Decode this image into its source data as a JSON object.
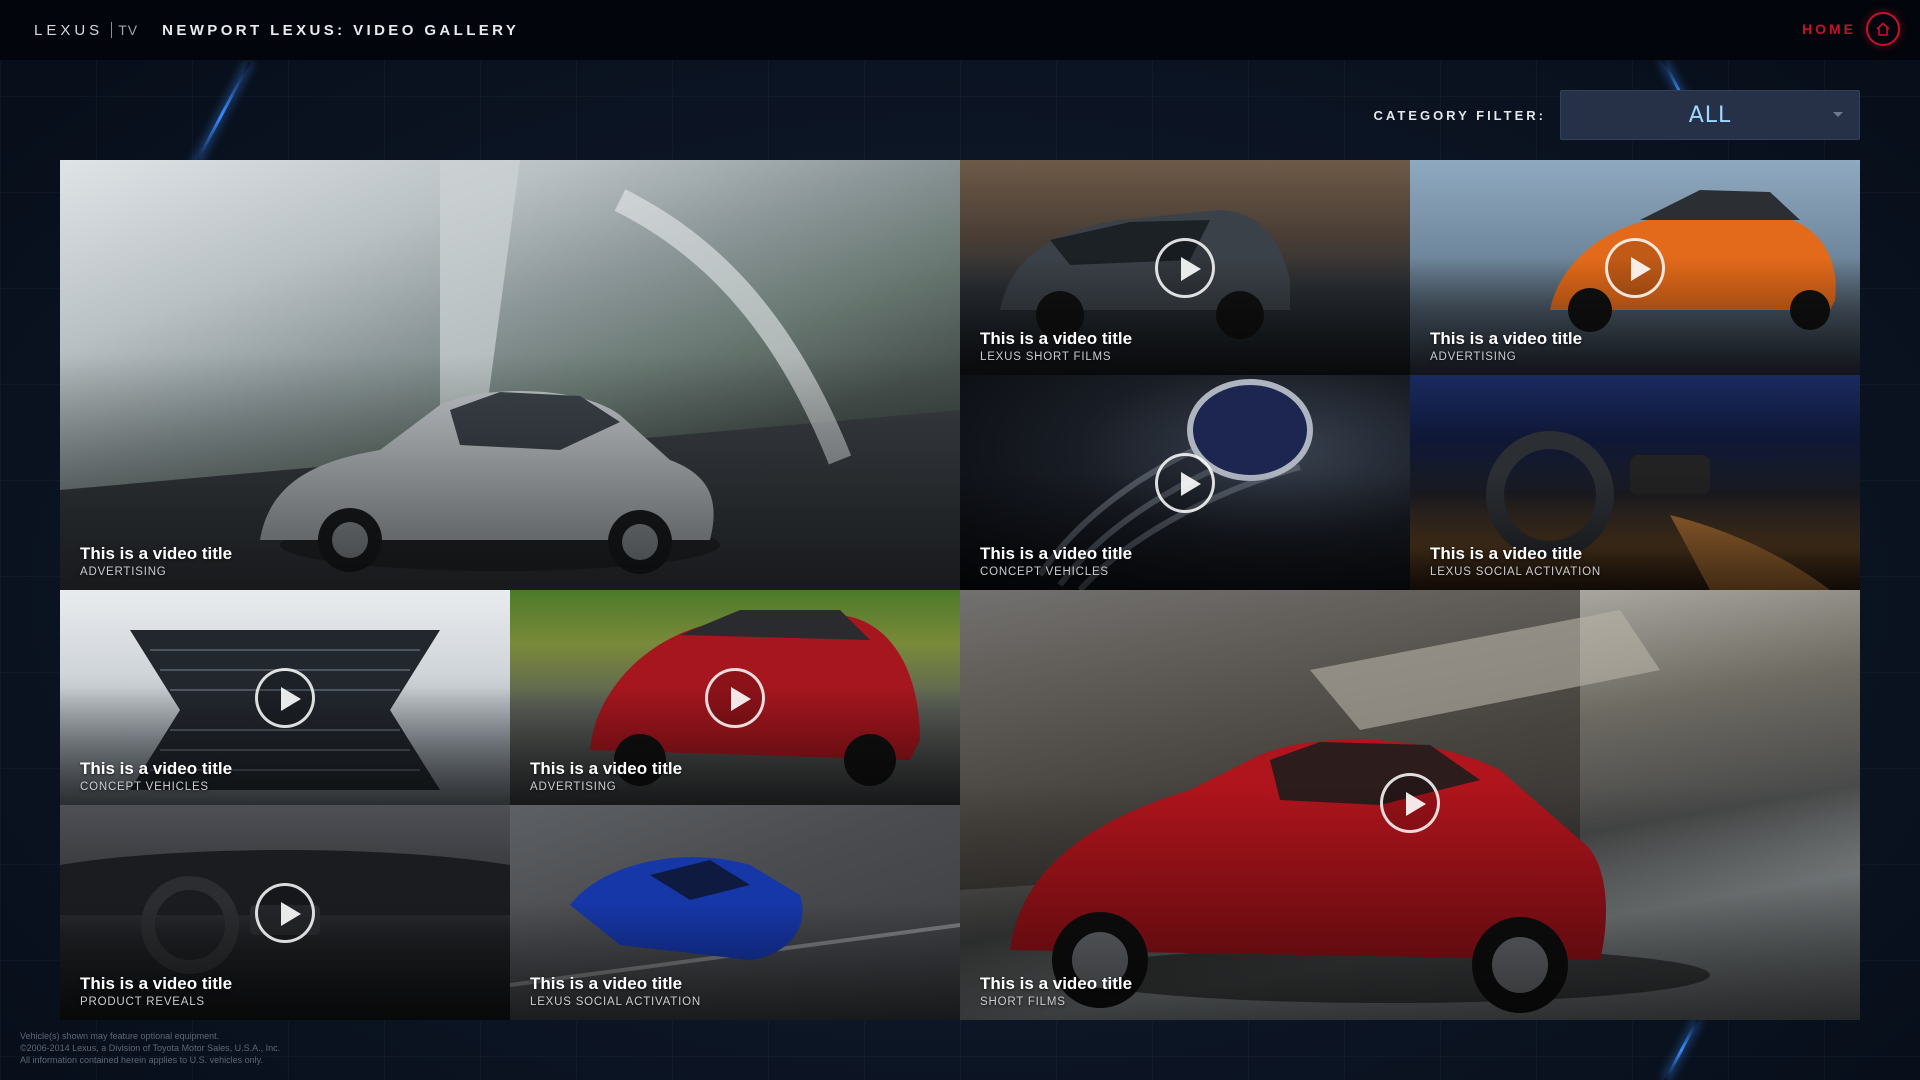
{
  "header": {
    "logo_word": "LEXUS",
    "logo_tv": "TV",
    "title": "NEWPORT LEXUS: VIDEO GALLERY",
    "home_label": "HOME",
    "home_icon": "house-icon"
  },
  "filter": {
    "label": "CATEGORY FILTER:",
    "value": "ALL"
  },
  "tiles": [
    {
      "title": "This is a video title",
      "category": "ADVERTISING"
    },
    {
      "title": "This is a video title",
      "category": "LEXUS SHORT FILMS"
    },
    {
      "title": "This is a video title",
      "category": "ADVERTISING"
    },
    {
      "title": "This is a video title",
      "category": "CONCEPT VEHICLES"
    },
    {
      "title": "This is a video title",
      "category": "LEXUS SOCIAL ACTIVATION"
    },
    {
      "title": "This is a video title",
      "category": "CONCEPT VEHICLES"
    },
    {
      "title": "This is a video title",
      "category": "ADVERTISING"
    },
    {
      "title": "This is a video title",
      "category": "SHORT FILMS"
    },
    {
      "title": "This is a video title",
      "category": "PRODUCT REVEALS"
    },
    {
      "title": "This is a video title",
      "category": "LEXUS SOCIAL ACTIVATION"
    }
  ],
  "legal": {
    "line1": "Vehicle(s) shown may feature optional equipment.",
    "line2": "©2006-2014 Lexus, a Division of Toyota Motor Sales, U.S.A., Inc.",
    "line3": "All information contained herein applies to U.S. vehicles only."
  },
  "colors": {
    "accent_red": "#c8102e",
    "filter_text": "#9fd8ff",
    "background": "#0b1320"
  }
}
